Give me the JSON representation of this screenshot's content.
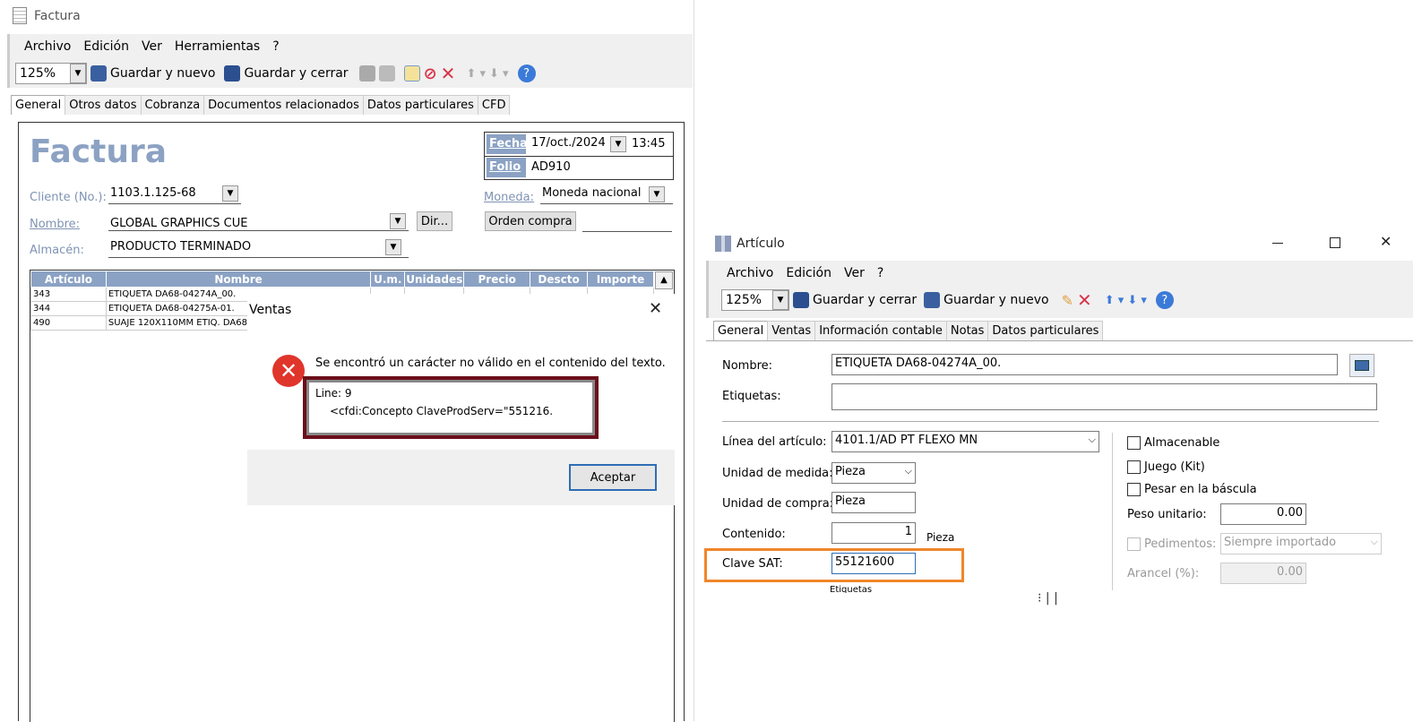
{
  "factura": {
    "window_title": "Factura",
    "menu": [
      "Archivo",
      "Edición",
      "Ver",
      "Herramientas",
      "?"
    ],
    "zoom": "125%",
    "save_new": "Guardar y nuevo",
    "save_close": "Guardar y cerrar",
    "tabs": [
      "General",
      "Otros datos",
      "Cobranza",
      "Documentos relacionados",
      "Datos particulares",
      "CFD"
    ],
    "heading": "Factura",
    "fecha_label": "Fecha",
    "fecha_value": "17/oct./2024",
    "hora": "13:45",
    "folio_label": "Folio",
    "folio_value": "AD910",
    "cliente_label": "Cliente (No.):",
    "cliente_value": "1103.1.125-68",
    "nombre_label": "Nombre:",
    "nombre_value": "GLOBAL GRAPHICS CUE",
    "dir_button": "Dir...",
    "almacen_label": "Almacén:",
    "almacen_value": "PRODUCTO TERMINADO",
    "moneda_label": "Moneda:",
    "moneda_value": "Moneda nacional",
    "orden_button": "Orden compra",
    "grid_headers": [
      "Artículo",
      "Nombre",
      "U.m.",
      "Unidades",
      "Precio",
      "Descto",
      "Importe"
    ],
    "grid_rows": [
      [
        "343",
        "ETIQUETA DA68-04274A_00."
      ],
      [
        "344",
        "ETIQUETA DA68-04275A-01."
      ],
      [
        "490",
        "SUAJE 120X110MM ETIQ. DA68-"
      ]
    ]
  },
  "dialog": {
    "title": "Ventas",
    "message": "Se encontró un carácter no válido en el contenido del texto.",
    "detail_line1": "Line: 9",
    "detail_line2": "<cfdi:Concepto ClaveProdServ=\"551216.",
    "ok_button": "Aceptar"
  },
  "articulo": {
    "window_title": "Artículo",
    "menu": [
      "Archivo",
      "Edición",
      "Ver",
      "?"
    ],
    "zoom": "125%",
    "save_close": "Guardar y cerrar",
    "save_new": "Guardar y nuevo",
    "tabs": [
      "General",
      "Ventas",
      "Información contable",
      "Notas",
      "Datos particulares"
    ],
    "nombre_label": "Nombre:",
    "nombre_value": "ETIQUETA DA68-04274A_00.",
    "etiquetas_label": "Etiquetas:",
    "linea_label": "Línea del artículo:",
    "linea_value": "4101.1/AD  PT FLEXO MN",
    "unidad_medida_label": "Unidad de medida:",
    "unidad_medida_value": "Pieza",
    "unidad_compra_label": "Unidad de compra:",
    "unidad_compra_value": "Pieza",
    "contenido_label": "Contenido:",
    "contenido_value": "1",
    "contenido_unit": "Pieza",
    "clave_label": "Clave SAT:",
    "clave_value": "55121600",
    "etiquetas_small": "Etiquetas",
    "almacenable": "Almacenable",
    "juego": "Juego (Kit)",
    "pesar": "Pesar en la báscula",
    "peso_label": "Peso unitario:",
    "peso_value": "0.00",
    "pedimentos_label": "Pedimentos:",
    "pedimentos_value": "Siempre importado",
    "arancel_label": "Arancel (%):",
    "arancel_value": "0.00"
  },
  "colors": {
    "highlight_dark_red": "#6b0f1a",
    "highlight_orange": "#f0862a",
    "grid_header": "#8ba2c4",
    "label_blue": "#7f93b3"
  }
}
